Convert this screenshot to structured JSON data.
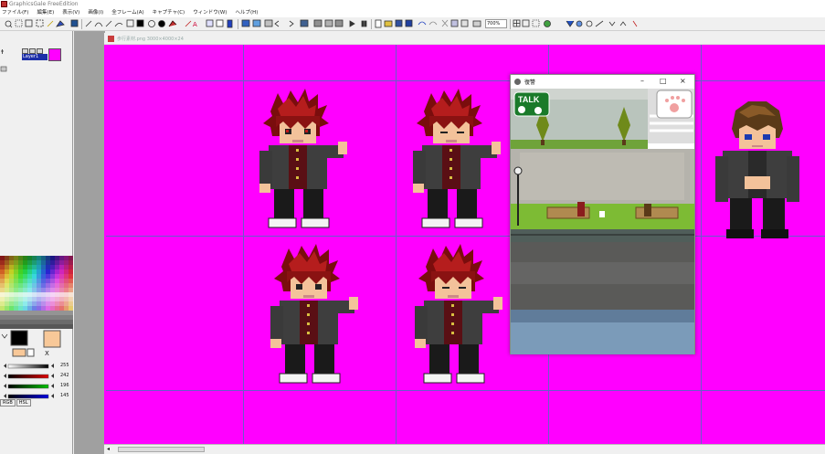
{
  "app": {
    "title": "GraphicsGale FreeEdition"
  },
  "menu": [
    "ファイル(F)",
    "編集(E)",
    "表示(V)",
    "画像(I)",
    "全フレーム(A)",
    "キャプチャ(C)",
    "ウィンドウ(W)",
    "ヘルプ(H)"
  ],
  "toolbar": {
    "zoom": "700%"
  },
  "layers": {
    "layer_name": "Layer1"
  },
  "sliders": {
    "r": "255",
    "g": "242",
    "b": "196",
    "a": "145"
  },
  "mode_tabs": [
    "RGB",
    "HSL"
  ],
  "canvas_window": {
    "title": "歩行素材.png 3000×4000×24",
    "color": "#ff00ff"
  },
  "game_window": {
    "title": "復讐",
    "talk_label": "TALK"
  },
  "colors": {
    "canvas_bg": "#ff00ff",
    "grid": "#6a5cc8",
    "selected_fg": "#000000",
    "selected_bg": "#f8c898"
  }
}
